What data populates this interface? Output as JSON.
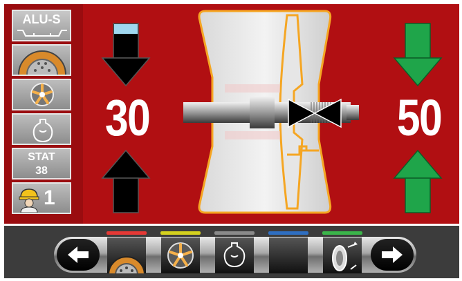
{
  "sidebar": {
    "mode_label": "ALU-S",
    "stat_label": "STAT",
    "stat_value": "38",
    "operator_number": "1"
  },
  "display": {
    "left_value": "30",
    "right_value": "50"
  },
  "colors": {
    "background_red": "#b10f12",
    "arrow_black": "#000000",
    "arrow_green": "#1fa54a",
    "rim_orange": "#f5a623",
    "indicator_blue_fill": "#9fd7ef"
  },
  "function_tabs": [
    {
      "color": "#e53935",
      "icon": "wheel-icon"
    },
    {
      "color": "#d4d11e",
      "icon": "alloy-rim-icon"
    },
    {
      "color": "#8a8a8a",
      "icon": "weight-icon"
    },
    {
      "color": "#2f6fc2",
      "icon": "blank-icon"
    },
    {
      "color": "#3bb54a",
      "icon": "tire-mount-icon"
    }
  ],
  "nav": {
    "prev_icon": "arrow-left-icon",
    "next_icon": "arrow-right-icon"
  }
}
